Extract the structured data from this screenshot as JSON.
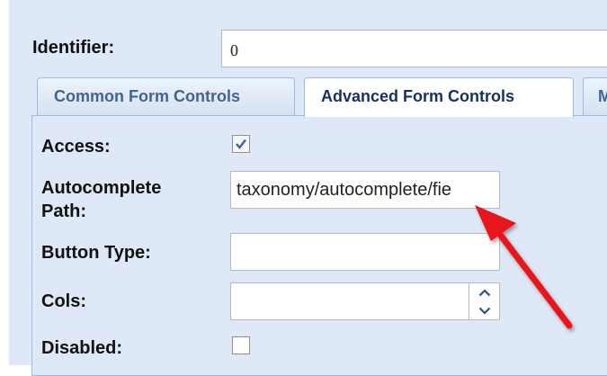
{
  "identifier": {
    "label": "Identifier:",
    "value": "0"
  },
  "tabs": [
    {
      "label": "Common Form Controls"
    },
    {
      "label": "Advanced Form Controls"
    },
    {
      "label": "M"
    }
  ],
  "fields": {
    "access": {
      "label": "Access:",
      "checked": true
    },
    "autocomplete_path": {
      "label_line1": "Autocomplete",
      "label_line2": "Path:",
      "value": "taxonomy/autocomplete/fie"
    },
    "button_type": {
      "label": "Button Type:",
      "value": ""
    },
    "cols": {
      "label": "Cols:",
      "value": ""
    },
    "disabled": {
      "label": "Disabled:",
      "checked": false
    }
  },
  "annotation": {
    "arrow_color": "#e8161b"
  }
}
